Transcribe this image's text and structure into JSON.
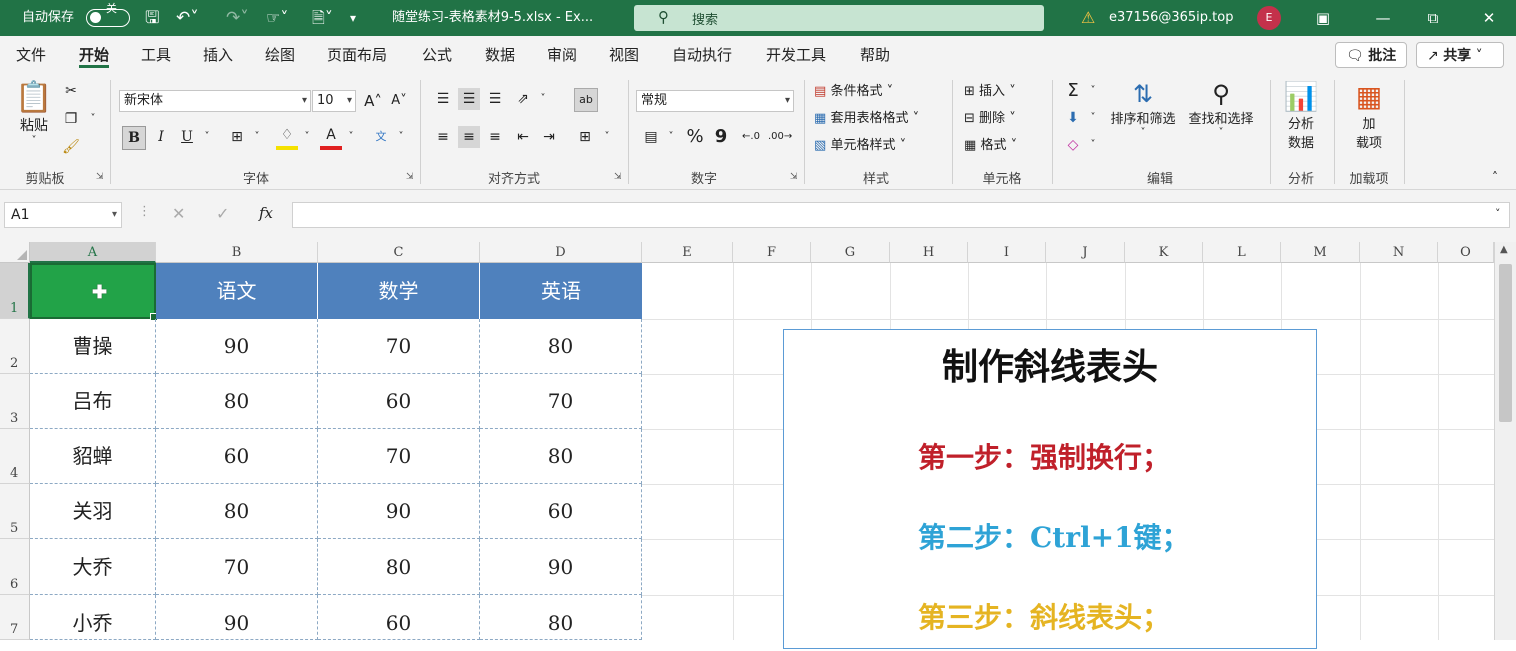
{
  "titlebar": {
    "autosave_label": "自动保存",
    "autosave_state": "关",
    "filename": "随堂练习-表格素材9-5.xlsx  -  Ex...",
    "search_placeholder": "搜索",
    "account": "e37156@365ip.top",
    "avatar_letter": "E",
    "warning_icon": "warning-icon"
  },
  "menu": {
    "tabs": [
      "文件",
      "开始",
      "工具",
      "插入",
      "绘图",
      "页面布局",
      "公式",
      "数据",
      "审阅",
      "视图",
      "自动执行",
      "开发工具",
      "帮助"
    ],
    "active_tab": "开始",
    "comment_button": "批注",
    "share_button": "共享"
  },
  "ribbon": {
    "clipboard": {
      "paste": "粘贴",
      "group": "剪贴板"
    },
    "font": {
      "font_name": "新宋体",
      "font_size": "10",
      "bold": "B",
      "italic": "I",
      "underline": "U",
      "group": "字体"
    },
    "alignment": {
      "group": "对齐方式"
    },
    "number": {
      "format": "常规",
      "percent": "%",
      "comma": "9",
      "group": "数字"
    },
    "styles": {
      "conditional": "条件格式",
      "table_format": "套用表格格式",
      "cell_styles": "单元格样式",
      "group": "样式"
    },
    "cells": {
      "insert": "插入",
      "delete": "删除",
      "format": "格式",
      "group": "单元格"
    },
    "editing": {
      "sort_filter": "排序和筛选",
      "find_select": "查找和选择",
      "group": "编辑"
    },
    "analysis": {
      "analyze_data_1": "分析",
      "analyze_data_2": "数据",
      "group": "分析"
    },
    "addins": {
      "addin_1": "加",
      "addin_2": "载项",
      "group": "加载项"
    }
  },
  "formula_bar": {
    "name_box": "A1",
    "fx": "fx",
    "formula": ""
  },
  "sheet": {
    "columns": [
      "A",
      "B",
      "C",
      "D",
      "E",
      "F",
      "G",
      "H",
      "I",
      "J",
      "K",
      "L",
      "M",
      "N",
      "O"
    ],
    "rows": [
      "1",
      "2",
      "3",
      "4",
      "5",
      "6",
      "7"
    ],
    "header": [
      "",
      "语文",
      "数学",
      "英语"
    ],
    "data": [
      [
        "曹操",
        "90",
        "70",
        "80"
      ],
      [
        "吕布",
        "80",
        "60",
        "70"
      ],
      [
        "貂蝉",
        "60",
        "70",
        "80"
      ],
      [
        "关羽",
        "80",
        "90",
        "60"
      ],
      [
        "大乔",
        "70",
        "80",
        "90"
      ],
      [
        "小乔",
        "90",
        "60",
        "80"
      ]
    ],
    "selected_cell": "A1"
  },
  "textbox": {
    "title": "制作斜线表头",
    "steps": [
      {
        "text": "第一步：强制换行；",
        "color": "#c0202a"
      },
      {
        "text": "第二步：Ctrl+1键；",
        "color": "#2ea3d6"
      },
      {
        "text": "第三步：斜线表头；",
        "color": "#e5b422"
      }
    ]
  },
  "colors": {
    "excel_green": "#217346",
    "header_blue": "#4f81bd",
    "selection_green": "#22a348"
  }
}
